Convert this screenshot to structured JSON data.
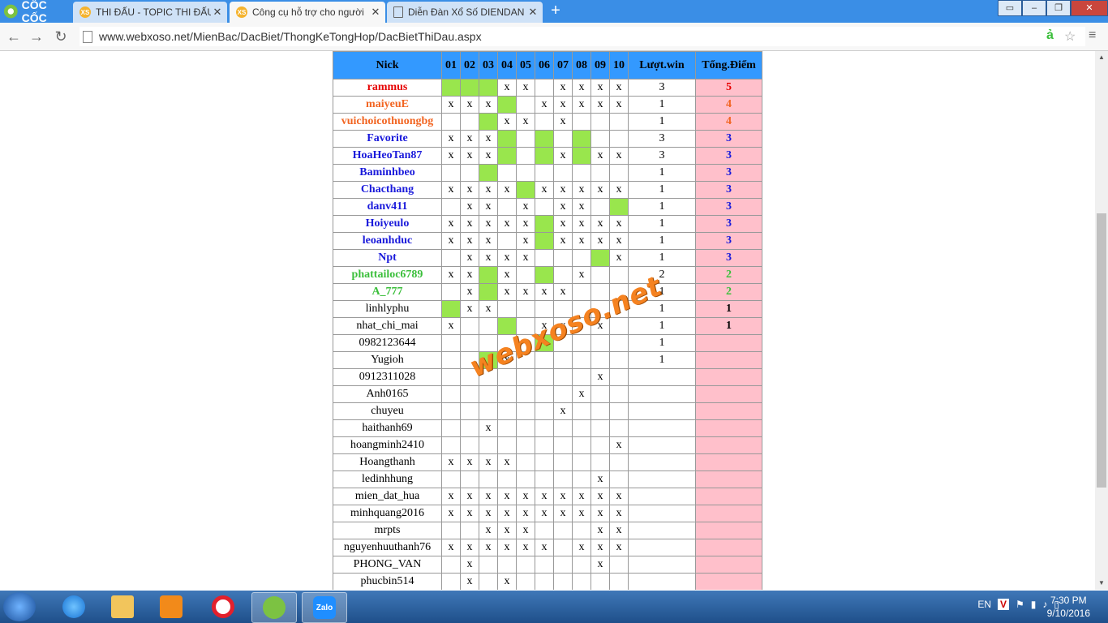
{
  "browser": {
    "brand": "CỐC CỐC",
    "tabs": [
      {
        "title": "THI ĐẤU - TOPIC THI ĐẤU",
        "active": false,
        "icon": "xs-favicon"
      },
      {
        "title": "Công cụ hỗ trợ cho người",
        "active": true,
        "icon": "xs-favicon"
      },
      {
        "title": "Diễn Đàn Xổ Số DIENDAN",
        "active": false,
        "icon": "page-icon"
      }
    ],
    "url": "www.webxoso.net/MienBac/DacBiet/ThongKeTongHop/DacBietThiDau.aspx"
  },
  "table": {
    "headers": [
      "Nick",
      "01",
      "02",
      "03",
      "04",
      "05",
      "06",
      "07",
      "08",
      "09",
      "10",
      "Lượt.win",
      "Tổng.Điểm"
    ],
    "rows": [
      {
        "nick": "rammus",
        "style": "red",
        "cells": [
          "G",
          "G",
          "G",
          "x",
          "x",
          "",
          "x",
          "x",
          "x",
          "x"
        ],
        "win": "3",
        "pts": "5"
      },
      {
        "nick": "maiyeuE",
        "style": "orange",
        "cells": [
          "x",
          "x",
          "x",
          "G",
          "",
          "x",
          "x",
          "x",
          "x",
          "x"
        ],
        "win": "1",
        "pts": "4"
      },
      {
        "nick": "vuichoicothuongbg",
        "style": "orange",
        "cells": [
          "",
          "",
          "G",
          "x",
          "x",
          "",
          "x",
          "",
          "",
          ""
        ],
        "win": "1",
        "pts": "4"
      },
      {
        "nick": "Favorite",
        "style": "blue",
        "cells": [
          "x",
          "x",
          "x",
          "G",
          "",
          "G",
          "",
          "G",
          "",
          ""
        ],
        "win": "3",
        "pts": "3"
      },
      {
        "nick": "HoaHeoTan87",
        "style": "blue",
        "cells": [
          "x",
          "x",
          "x",
          "G",
          "",
          "G",
          "x",
          "G",
          "x",
          "x"
        ],
        "win": "3",
        "pts": "3"
      },
      {
        "nick": "Baminhbeo",
        "style": "blue",
        "cells": [
          "",
          "",
          "G",
          "",
          "",
          "",
          "",
          "",
          "",
          ""
        ],
        "win": "1",
        "pts": "3"
      },
      {
        "nick": "Chacthang",
        "style": "blue",
        "cells": [
          "x",
          "x",
          "x",
          "x",
          "G",
          "x",
          "x",
          "x",
          "x",
          "x"
        ],
        "win": "1",
        "pts": "3"
      },
      {
        "nick": "danv411",
        "style": "blue",
        "cells": [
          "",
          "x",
          "x",
          "",
          "x",
          "",
          "x",
          "x",
          "",
          "G"
        ],
        "win": "1",
        "pts": "3"
      },
      {
        "nick": "Hoiyeulo",
        "style": "blue",
        "cells": [
          "x",
          "x",
          "x",
          "x",
          "x",
          "G",
          "x",
          "x",
          "x",
          "x"
        ],
        "win": "1",
        "pts": "3"
      },
      {
        "nick": "leoanhduc",
        "style": "blue",
        "cells": [
          "x",
          "x",
          "x",
          "",
          "x",
          "G",
          "x",
          "x",
          "x",
          "x"
        ],
        "win": "1",
        "pts": "3"
      },
      {
        "nick": "Npt",
        "style": "blue",
        "cells": [
          "",
          "x",
          "x",
          "x",
          "x",
          "",
          "",
          "",
          "G",
          "x"
        ],
        "win": "1",
        "pts": "3"
      },
      {
        "nick": "phattailoc6789",
        "style": "green",
        "cells": [
          "x",
          "x",
          "G",
          "x",
          "",
          "G",
          "",
          "x",
          "",
          ""
        ],
        "win": "2",
        "pts": "2"
      },
      {
        "nick": "A_777",
        "style": "green",
        "cells": [
          "",
          "x",
          "G",
          "x",
          "x",
          "x",
          "x",
          "",
          "",
          ""
        ],
        "win": "1",
        "pts": "2"
      },
      {
        "nick": "linhlyphu",
        "style": "plain",
        "cells": [
          "G",
          "x",
          "x",
          "",
          "",
          "",
          "",
          "",
          "",
          ""
        ],
        "win": "1",
        "pts": "1"
      },
      {
        "nick": "nhat_chi_mai",
        "style": "plain",
        "cells": [
          "x",
          "",
          "",
          "G",
          "",
          "x",
          "x",
          "",
          "x",
          ""
        ],
        "win": "1",
        "pts": "1"
      },
      {
        "nick": "0982123644",
        "style": "plain",
        "cells": [
          "",
          "",
          "",
          "",
          "",
          "G",
          "",
          "",
          "",
          ""
        ],
        "win": "1",
        "pts": ""
      },
      {
        "nick": "Yugioh",
        "style": "plain",
        "cells": [
          "",
          "",
          "G",
          "x",
          "",
          "",
          "",
          "",
          "",
          ""
        ],
        "win": "1",
        "pts": ""
      },
      {
        "nick": "0912311028",
        "style": "plain",
        "cells": [
          "",
          "",
          "",
          "",
          "",
          "",
          "",
          "",
          "x",
          ""
        ],
        "win": "",
        "pts": ""
      },
      {
        "nick": "Anh0165",
        "style": "plain",
        "cells": [
          "",
          "",
          "",
          "",
          "",
          "",
          "",
          "x",
          "",
          ""
        ],
        "win": "",
        "pts": ""
      },
      {
        "nick": "chuyeu",
        "style": "plain",
        "cells": [
          "",
          "",
          "",
          "",
          "",
          "",
          "x",
          "",
          "",
          ""
        ],
        "win": "",
        "pts": ""
      },
      {
        "nick": "haithanh69",
        "style": "plain",
        "cells": [
          "",
          "",
          "x",
          "",
          "",
          "",
          "",
          "",
          "",
          ""
        ],
        "win": "",
        "pts": ""
      },
      {
        "nick": "hoangminh2410",
        "style": "plain",
        "cells": [
          "",
          "",
          "",
          "",
          "",
          "",
          "",
          "",
          "",
          "x"
        ],
        "win": "",
        "pts": ""
      },
      {
        "nick": "Hoangthanh",
        "style": "plain",
        "cells": [
          "x",
          "x",
          "x",
          "x",
          "",
          "",
          "",
          "",
          "",
          ""
        ],
        "win": "",
        "pts": ""
      },
      {
        "nick": "ledinhhung",
        "style": "plain",
        "cells": [
          "",
          "",
          "",
          "",
          "",
          "",
          "",
          "",
          "x",
          ""
        ],
        "win": "",
        "pts": ""
      },
      {
        "nick": "mien_dat_hua",
        "style": "plain",
        "cells": [
          "x",
          "x",
          "x",
          "x",
          "x",
          "x",
          "x",
          "x",
          "x",
          "x"
        ],
        "win": "",
        "pts": ""
      },
      {
        "nick": "minhquang2016",
        "style": "plain",
        "cells": [
          "x",
          "x",
          "x",
          "x",
          "x",
          "x",
          "x",
          "x",
          "x",
          "x"
        ],
        "win": "",
        "pts": ""
      },
      {
        "nick": "mrpts",
        "style": "plain",
        "cells": [
          "",
          "",
          "x",
          "x",
          "x",
          "",
          "",
          "",
          "x",
          "x"
        ],
        "win": "",
        "pts": ""
      },
      {
        "nick": "nguyenhuuthanh76",
        "style": "plain",
        "cells": [
          "x",
          "x",
          "x",
          "x",
          "x",
          "x",
          "",
          "x",
          "x",
          "x"
        ],
        "win": "",
        "pts": ""
      },
      {
        "nick": "PHONG_VAN",
        "style": "plain",
        "cells": [
          "",
          "x",
          "",
          "",
          "",
          "",
          "",
          "",
          "x",
          ""
        ],
        "win": "",
        "pts": ""
      },
      {
        "nick": "phucbin514",
        "style": "plain",
        "cells": [
          "",
          "x",
          "",
          "x",
          "",
          "",
          "",
          "",
          "",
          ""
        ],
        "win": "",
        "pts": ""
      }
    ]
  },
  "watermark": "webxoso.net",
  "taskbar": {
    "lang": "EN",
    "time": "7:30 PM",
    "date": "9/10/2016",
    "apps": [
      "internet-explorer-icon",
      "file-explorer-icon",
      "media-player-icon",
      "opera-icon",
      "coccoc-icon",
      "zalo-icon"
    ],
    "zalo_label": "Zalo"
  },
  "colors": {
    "header": "#3399ff",
    "win_cell": "#99e64d",
    "points_bg": "#ffc0cb"
  }
}
